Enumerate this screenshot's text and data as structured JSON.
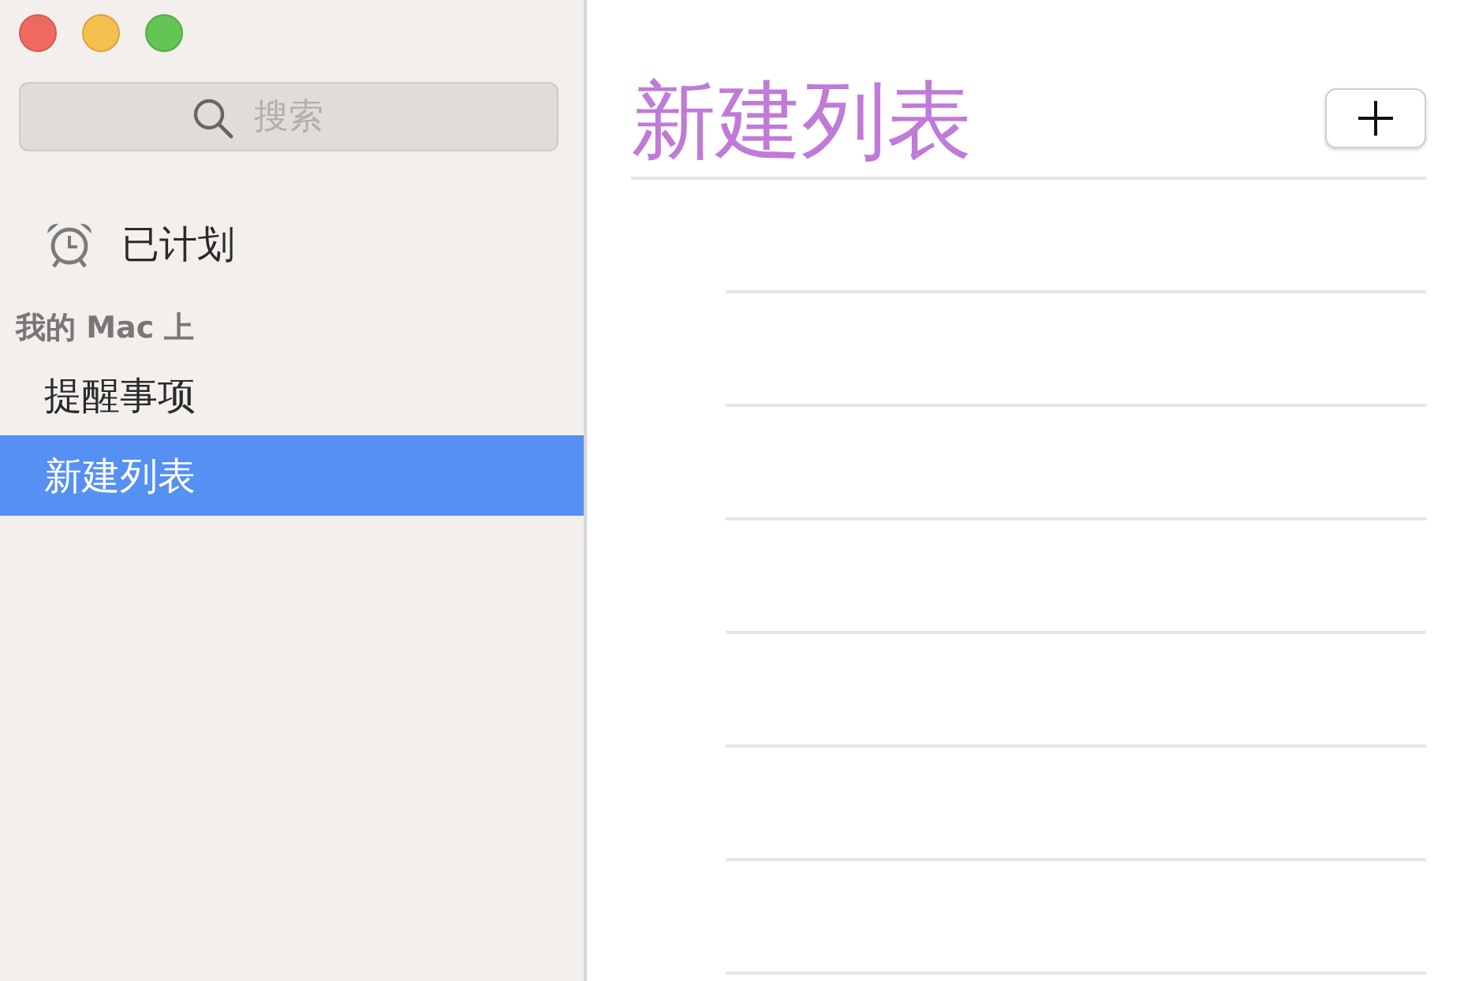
{
  "search": {
    "placeholder": "搜索"
  },
  "sidebar": {
    "smart_lists": [
      {
        "kind": "scheduled",
        "label": "已计划",
        "selected": false
      }
    ],
    "sections": [
      {
        "title": "我的 Mac 上",
        "items": [
          {
            "label": "提醒事项",
            "selected": false
          },
          {
            "label": "新建列表",
            "selected": true
          }
        ]
      }
    ]
  },
  "list": {
    "title": "新建列表"
  }
}
